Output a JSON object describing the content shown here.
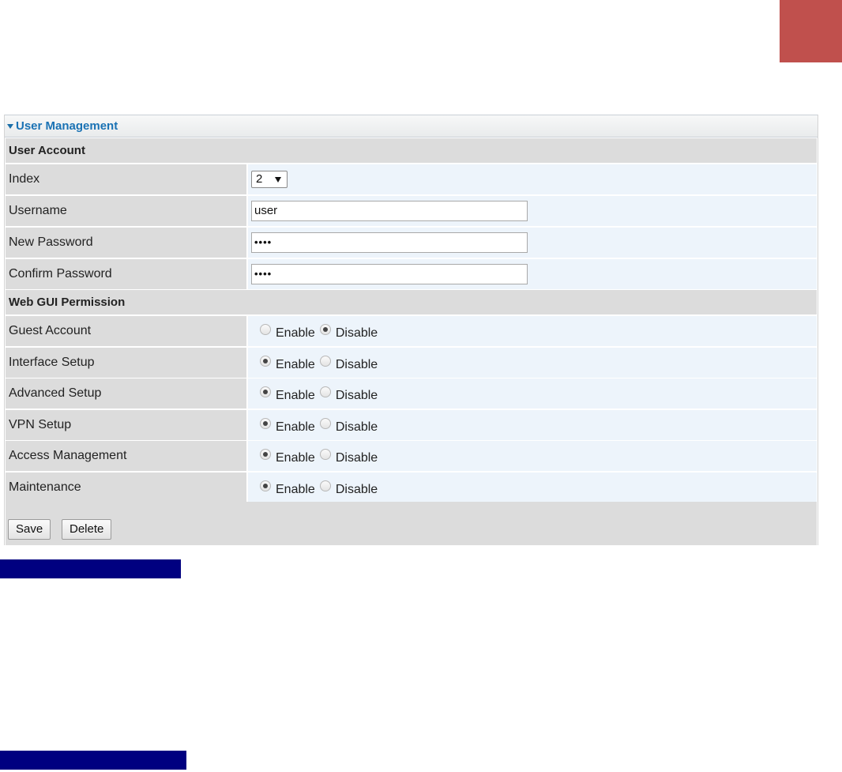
{
  "panel": {
    "title": "User Management"
  },
  "sections": {
    "user_account": "User Account",
    "web_gui_permission": "Web GUI Permission"
  },
  "user_account": {
    "index_label": "Index",
    "index_value": "2",
    "username_label": "Username",
    "username_value": "user",
    "new_password_label": "New Password",
    "new_password_value": "••••",
    "confirm_password_label": "Confirm Password",
    "confirm_password_value": "••••"
  },
  "options": {
    "enable": "Enable",
    "disable": "Disable"
  },
  "permissions": [
    {
      "label": "Guest Account",
      "selected": "disable"
    },
    {
      "label": "Interface Setup",
      "selected": "enable"
    },
    {
      "label": "Advanced Setup",
      "selected": "enable"
    },
    {
      "label": "VPN Setup",
      "selected": "enable"
    },
    {
      "label": "Access Management",
      "selected": "enable"
    },
    {
      "label": "Maintenance",
      "selected": "enable"
    }
  ],
  "buttons": {
    "save": "Save",
    "delete": "Delete"
  },
  "colors": {
    "accent_block": "#c0504d",
    "navy_bar": "#000080",
    "title_blue": "#1a72b4"
  }
}
